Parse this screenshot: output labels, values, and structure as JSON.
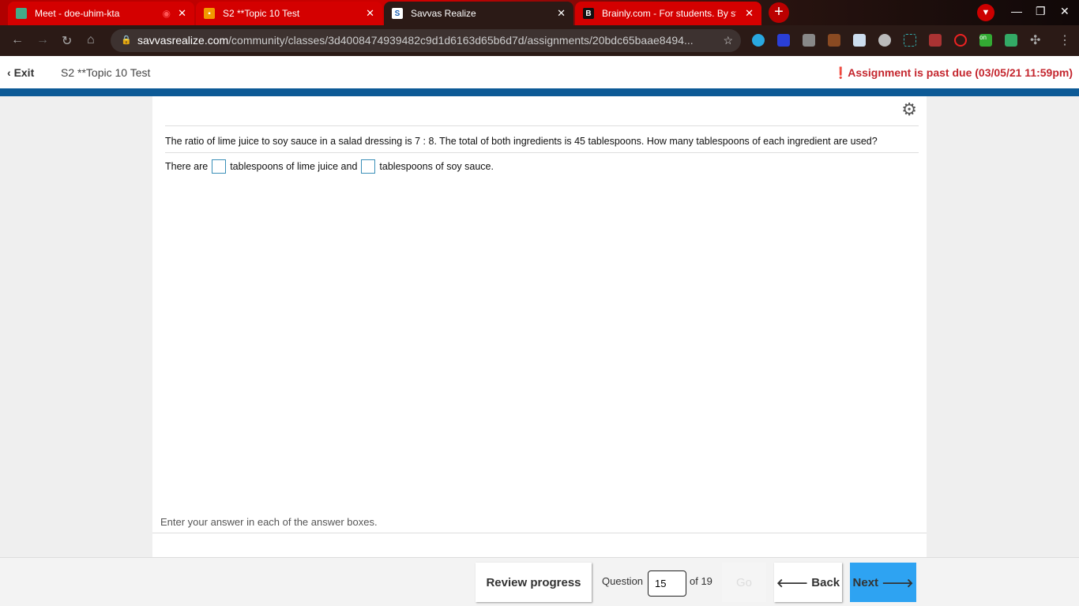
{
  "browser": {
    "tabs": [
      {
        "label": "Meet - doe-uhim-kta",
        "icon": "google-meet-icon"
      },
      {
        "label": "S2 **Topic 10 Test",
        "icon": "classroom-icon"
      },
      {
        "label": "Savvas Realize",
        "icon": "savvas-icon",
        "active": true
      },
      {
        "label": "Brainly.com - For students. By st",
        "icon": "brainly-icon"
      }
    ],
    "url_domain": "savvasrealize.com",
    "url_path": "/community/classes/3d4008474939482c9d1d6163d65b6d7d/assignments/20bdc65baae8494...",
    "ext_badge": "on"
  },
  "header": {
    "exit_label": "Exit",
    "title": "S2 **Topic 10 Test",
    "past_due": "Assignment is past due (03/05/21 11:59pm)",
    "accent": "#c4262e",
    "bar_color": "#0d5a96"
  },
  "question": {
    "text": "The ratio of lime juice to soy sauce in a salad dressing is 7 : 8. The total of both ingredients is 45 tablespoons. How many tablespoons of each ingredient are used?",
    "answer_parts": [
      "There are",
      "tablespoons of lime juice and",
      "tablespoons of soy sauce."
    ],
    "hint": "Enter your answer in each of the answer boxes."
  },
  "footer": {
    "review": "Review progress",
    "question_label": "Question",
    "question_number": "15",
    "of_total": "of 19",
    "go": "Go",
    "back": "Back",
    "next": "Next",
    "next_color": "#2ea3f2"
  }
}
